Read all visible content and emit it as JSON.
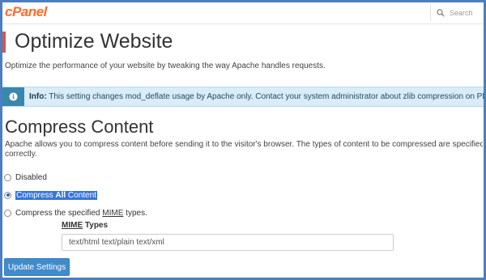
{
  "header": {
    "logo_text": "cPanel",
    "search_placeholder": "Search"
  },
  "page": {
    "title": "Optimize Website",
    "description": "Optimize the performance of your website by tweaking the way Apache handles requests."
  },
  "alert": {
    "label": "Info:",
    "message": " This setting changes mod_deflate usage by Apache only. Contact your system administrator about zlib compression on PHP scripts."
  },
  "compress": {
    "title": "Compress Content",
    "description_line1": "Apache allows you to compress content before sending it to the visitor's browser. The types of content to be compressed are specified by MIME typ",
    "description_line2": "correctly.",
    "options": {
      "disabled": "Disabled",
      "all_prefix": "Compress ",
      "all_strong": "All",
      "all_suffix": " Content",
      "specified_prefix": "Compress the specified ",
      "specified_mime": "MIME",
      "specified_suffix": " types."
    },
    "selected_option": "Compress All Content",
    "mime_label_abbr": "MIME",
    "mime_label_rest": " Types",
    "mime_value": "text/html text/plain text/xml",
    "submit_label": "Update Settings"
  },
  "colors": {
    "brand": "#ff6c2c",
    "title_accent": "#d9534f",
    "info_background": "#d9ecf7",
    "info_icon": "#3a87ad",
    "primary_button": "#428bca",
    "selection": "#3875d7",
    "frame_border": "#4a7fc1"
  }
}
